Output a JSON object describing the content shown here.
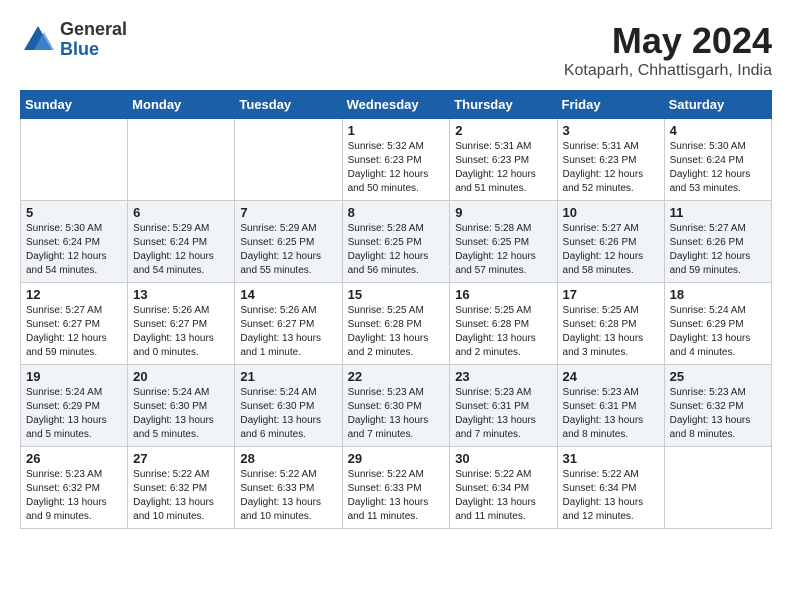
{
  "header": {
    "logo_general": "General",
    "logo_blue": "Blue",
    "month_year": "May 2024",
    "location": "Kotaparh, Chhattisgarh, India"
  },
  "weekdays": [
    "Sunday",
    "Monday",
    "Tuesday",
    "Wednesday",
    "Thursday",
    "Friday",
    "Saturday"
  ],
  "weeks": [
    [
      {
        "day": "",
        "info": ""
      },
      {
        "day": "",
        "info": ""
      },
      {
        "day": "",
        "info": ""
      },
      {
        "day": "1",
        "info": "Sunrise: 5:32 AM\nSunset: 6:23 PM\nDaylight: 12 hours\nand 50 minutes."
      },
      {
        "day": "2",
        "info": "Sunrise: 5:31 AM\nSunset: 6:23 PM\nDaylight: 12 hours\nand 51 minutes."
      },
      {
        "day": "3",
        "info": "Sunrise: 5:31 AM\nSunset: 6:23 PM\nDaylight: 12 hours\nand 52 minutes."
      },
      {
        "day": "4",
        "info": "Sunrise: 5:30 AM\nSunset: 6:24 PM\nDaylight: 12 hours\nand 53 minutes."
      }
    ],
    [
      {
        "day": "5",
        "info": "Sunrise: 5:30 AM\nSunset: 6:24 PM\nDaylight: 12 hours\nand 54 minutes."
      },
      {
        "day": "6",
        "info": "Sunrise: 5:29 AM\nSunset: 6:24 PM\nDaylight: 12 hours\nand 54 minutes."
      },
      {
        "day": "7",
        "info": "Sunrise: 5:29 AM\nSunset: 6:25 PM\nDaylight: 12 hours\nand 55 minutes."
      },
      {
        "day": "8",
        "info": "Sunrise: 5:28 AM\nSunset: 6:25 PM\nDaylight: 12 hours\nand 56 minutes."
      },
      {
        "day": "9",
        "info": "Sunrise: 5:28 AM\nSunset: 6:25 PM\nDaylight: 12 hours\nand 57 minutes."
      },
      {
        "day": "10",
        "info": "Sunrise: 5:27 AM\nSunset: 6:26 PM\nDaylight: 12 hours\nand 58 minutes."
      },
      {
        "day": "11",
        "info": "Sunrise: 5:27 AM\nSunset: 6:26 PM\nDaylight: 12 hours\nand 59 minutes."
      }
    ],
    [
      {
        "day": "12",
        "info": "Sunrise: 5:27 AM\nSunset: 6:27 PM\nDaylight: 12 hours\nand 59 minutes."
      },
      {
        "day": "13",
        "info": "Sunrise: 5:26 AM\nSunset: 6:27 PM\nDaylight: 13 hours\nand 0 minutes."
      },
      {
        "day": "14",
        "info": "Sunrise: 5:26 AM\nSunset: 6:27 PM\nDaylight: 13 hours\nand 1 minute."
      },
      {
        "day": "15",
        "info": "Sunrise: 5:25 AM\nSunset: 6:28 PM\nDaylight: 13 hours\nand 2 minutes."
      },
      {
        "day": "16",
        "info": "Sunrise: 5:25 AM\nSunset: 6:28 PM\nDaylight: 13 hours\nand 2 minutes."
      },
      {
        "day": "17",
        "info": "Sunrise: 5:25 AM\nSunset: 6:28 PM\nDaylight: 13 hours\nand 3 minutes."
      },
      {
        "day": "18",
        "info": "Sunrise: 5:24 AM\nSunset: 6:29 PM\nDaylight: 13 hours\nand 4 minutes."
      }
    ],
    [
      {
        "day": "19",
        "info": "Sunrise: 5:24 AM\nSunset: 6:29 PM\nDaylight: 13 hours\nand 5 minutes."
      },
      {
        "day": "20",
        "info": "Sunrise: 5:24 AM\nSunset: 6:30 PM\nDaylight: 13 hours\nand 5 minutes."
      },
      {
        "day": "21",
        "info": "Sunrise: 5:24 AM\nSunset: 6:30 PM\nDaylight: 13 hours\nand 6 minutes."
      },
      {
        "day": "22",
        "info": "Sunrise: 5:23 AM\nSunset: 6:30 PM\nDaylight: 13 hours\nand 7 minutes."
      },
      {
        "day": "23",
        "info": "Sunrise: 5:23 AM\nSunset: 6:31 PM\nDaylight: 13 hours\nand 7 minutes."
      },
      {
        "day": "24",
        "info": "Sunrise: 5:23 AM\nSunset: 6:31 PM\nDaylight: 13 hours\nand 8 minutes."
      },
      {
        "day": "25",
        "info": "Sunrise: 5:23 AM\nSunset: 6:32 PM\nDaylight: 13 hours\nand 8 minutes."
      }
    ],
    [
      {
        "day": "26",
        "info": "Sunrise: 5:23 AM\nSunset: 6:32 PM\nDaylight: 13 hours\nand 9 minutes."
      },
      {
        "day": "27",
        "info": "Sunrise: 5:22 AM\nSunset: 6:32 PM\nDaylight: 13 hours\nand 10 minutes."
      },
      {
        "day": "28",
        "info": "Sunrise: 5:22 AM\nSunset: 6:33 PM\nDaylight: 13 hours\nand 10 minutes."
      },
      {
        "day": "29",
        "info": "Sunrise: 5:22 AM\nSunset: 6:33 PM\nDaylight: 13 hours\nand 11 minutes."
      },
      {
        "day": "30",
        "info": "Sunrise: 5:22 AM\nSunset: 6:34 PM\nDaylight: 13 hours\nand 11 minutes."
      },
      {
        "day": "31",
        "info": "Sunrise: 5:22 AM\nSunset: 6:34 PM\nDaylight: 13 hours\nand 12 minutes."
      },
      {
        "day": "",
        "info": ""
      }
    ]
  ]
}
